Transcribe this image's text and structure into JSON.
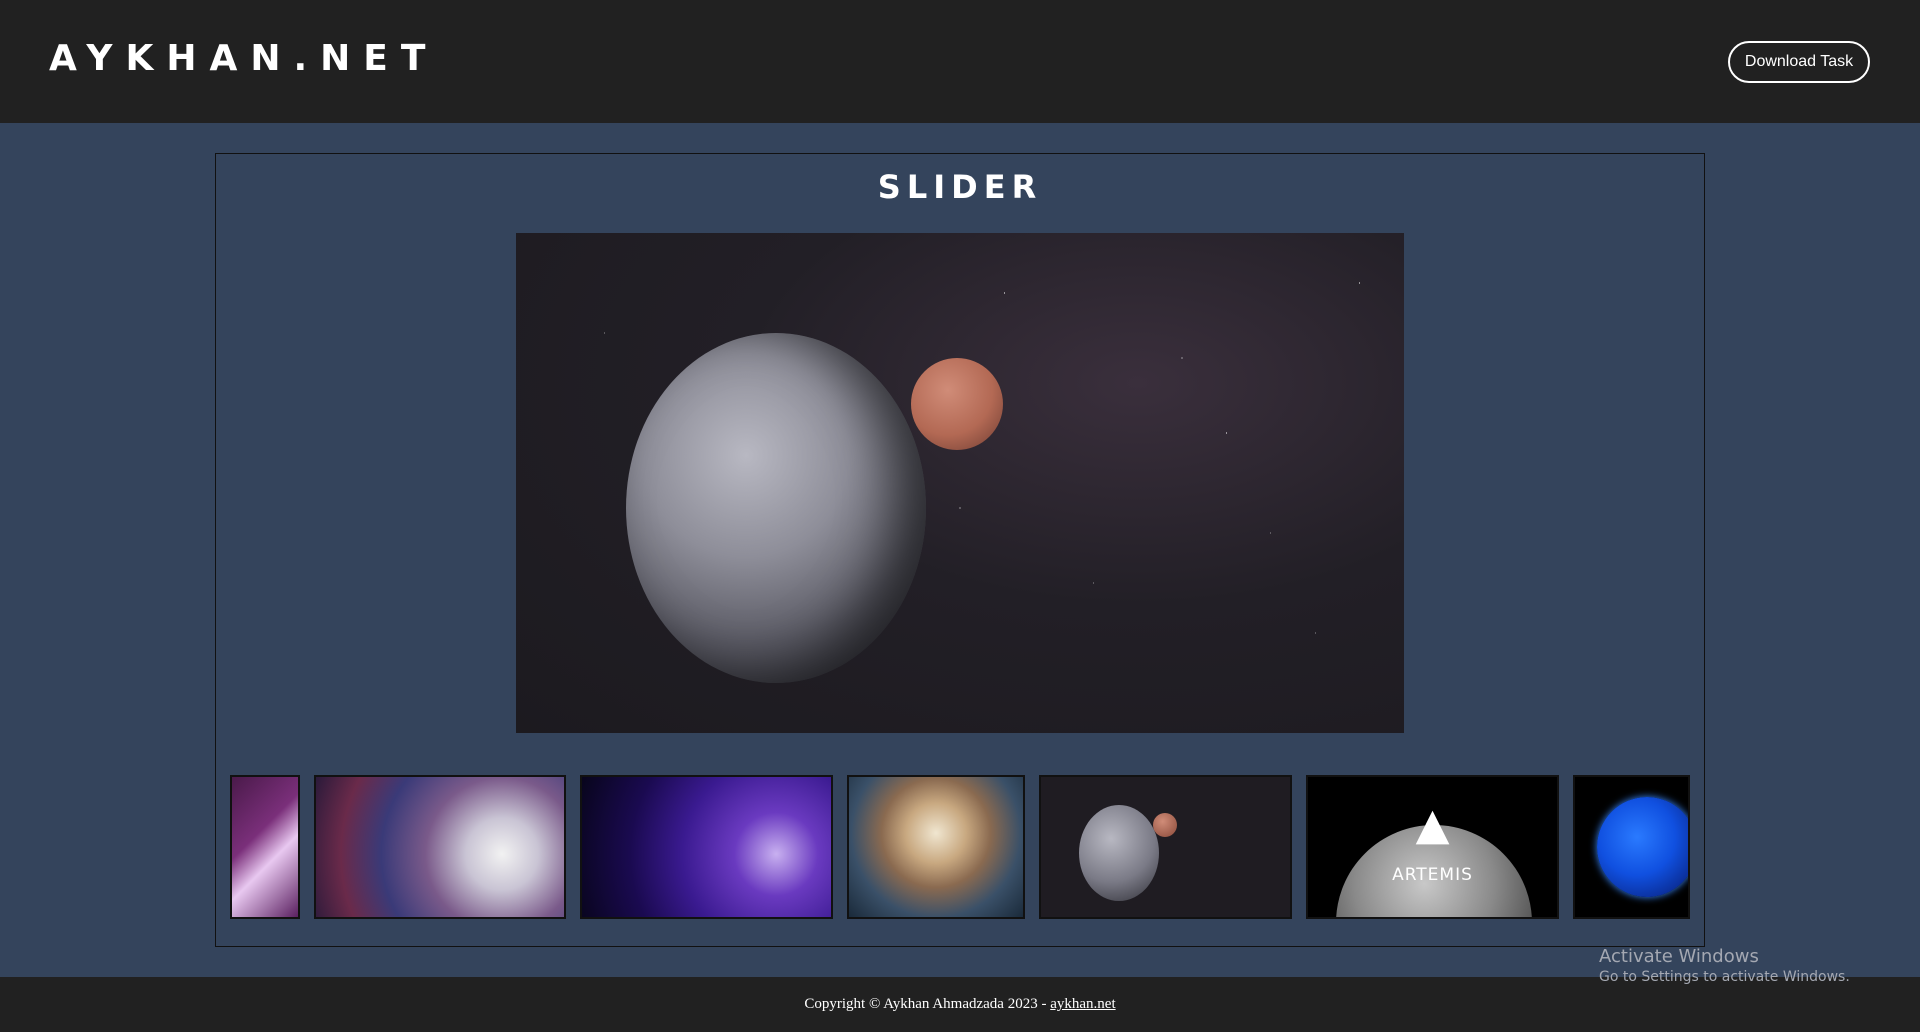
{
  "header": {
    "logo": "AYKHAN.NET",
    "download_label": "Download Task"
  },
  "slider": {
    "title": "SLIDER",
    "main_image": "moon-and-planet-space",
    "thumbnails": [
      {
        "name": "purple-abstract"
      },
      {
        "name": "cosmic-wormhole"
      },
      {
        "name": "purple-planets"
      },
      {
        "name": "nebula-cloud"
      },
      {
        "name": "moon-and-planet",
        "active": true
      },
      {
        "name": "artemis-logo",
        "label": "ARTEMIS"
      },
      {
        "name": "blue-planet"
      }
    ]
  },
  "footer": {
    "copyright": "Copyright © Aykhan Ahmadzada 2023 - ",
    "link": "aykhan.net"
  },
  "watermark": {
    "line1": "Activate Windows",
    "line2": "Go to Settings to activate Windows."
  },
  "colors": {
    "header_bg": "#212121",
    "body_bg": "#34445c",
    "text": "#ffffff"
  }
}
